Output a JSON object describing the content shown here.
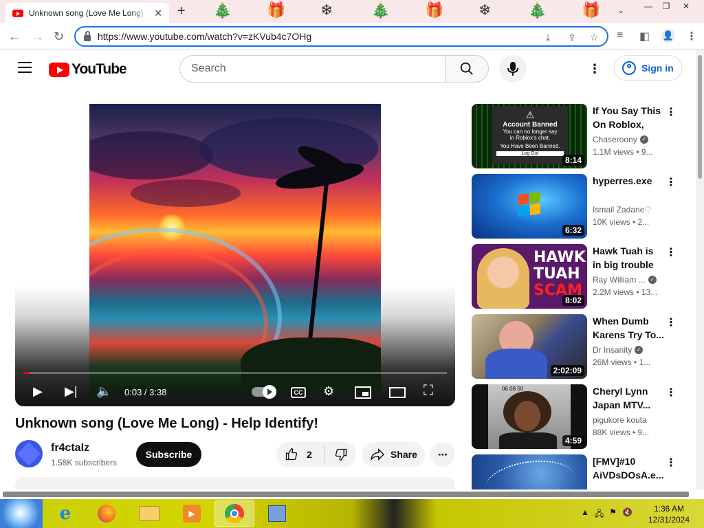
{
  "browser": {
    "tab_title": "Unknown song (Love Me Long) - Help Identify!",
    "url": "https://www.youtube.com/watch?v=zKVub4c7OHg"
  },
  "youtube": {
    "logo_text": "YouTube",
    "search_placeholder": "Search",
    "signin_label": "Sign in"
  },
  "player": {
    "time": "0:03 / 3:38",
    "cc_label": "CC",
    "progress_fraction": 0.014
  },
  "video": {
    "title": "Unknown song (Love Me Long) - Help Identify!",
    "channel": "fr4ctalz",
    "subscribers": "1.58K subscribers",
    "subscribe_label": "Subscribe",
    "likes": "2",
    "share_label": "Share"
  },
  "recommendations": [
    {
      "title": "If You Say This On Roblox, Yo...",
      "channel": "Chaseroony",
      "verified": true,
      "meta": "1.1M views • 9...",
      "duration": "8:14"
    },
    {
      "title": "hyperres.exe",
      "channel": "Ismail Zadane♡",
      "verified": false,
      "meta": "10K views • 2...",
      "duration": "6:32"
    },
    {
      "title": "Hawk Tuah is in big trouble now",
      "channel": "Ray William ...",
      "verified": true,
      "meta": "2.2M views • 13...",
      "duration": "8:02"
    },
    {
      "title": "When Dumb Karens Try To...",
      "channel": "Dr Insanity",
      "verified": true,
      "meta": "26M views • 1...",
      "duration": "2:02:09"
    },
    {
      "title": "Cheryl Lynn Japan MTV...",
      "channel": "pigukore kouta",
      "verified": false,
      "meta": "88K views • 9...",
      "duration": "4:59"
    },
    {
      "title": "[FMV]#10 AiVDsDOsA.e...",
      "channel": "",
      "verified": false,
      "meta": "",
      "duration": ""
    }
  ],
  "thumb_text": {
    "banned_title": "Account Banned",
    "banned_line1": "You can no longer say",
    "banned_line2": "in Roblox's chat.",
    "banned_line3": "You Have Been Banned.",
    "banned_button": "Log Out",
    "hawk_line1": "HAWK",
    "hawk_line2": "TUAH",
    "hawk_line3": "SCAM",
    "cheryl_time": "06 08 50"
  },
  "taskbar": {
    "time": "1:36 AM",
    "date": "12/31/2024"
  },
  "colors": {
    "youtube_red": "#ff0000",
    "link_blue": "#065fd4",
    "omnibox_focus": "#1a73e8"
  }
}
